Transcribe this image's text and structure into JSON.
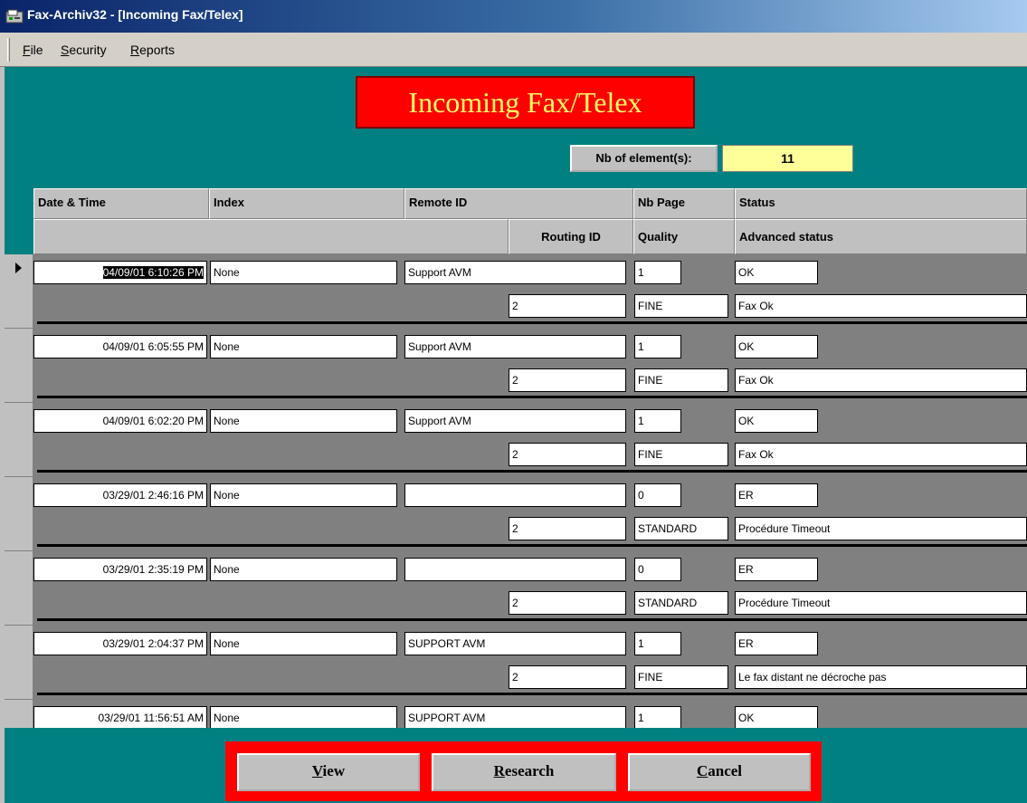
{
  "window": {
    "title": "Fax-Archiv32 - [Incoming Fax/Telex]"
  },
  "menu": [
    {
      "pre": "",
      "key": "F",
      "post": "ile"
    },
    {
      "pre": "",
      "key": "S",
      "post": "ecurity"
    },
    {
      "pre": "",
      "key": "R",
      "post": "eports"
    }
  ],
  "banner": "Incoming Fax/Telex",
  "count": {
    "label": "Nb of element(s):",
    "value": "11"
  },
  "headers": {
    "date_time": "Date & Time",
    "index": "Index",
    "remote_id": "Remote ID",
    "nb_page": "Nb Page",
    "status": "Status",
    "routing_id": "Routing ID",
    "quality": "Quality",
    "advanced_status": "Advanced status"
  },
  "records": [
    {
      "datetime": "04/09/01 6:10:26 PM",
      "index": "None",
      "remote_id": "Support AVM",
      "nb_page": "1",
      "status": "OK",
      "routing_id": "2",
      "quality": "FINE",
      "advanced_status": "Fax Ok",
      "current": true
    },
    {
      "datetime": "04/09/01 6:05:55 PM",
      "index": "None",
      "remote_id": "Support AVM",
      "nb_page": "1",
      "status": "OK",
      "routing_id": "2",
      "quality": "FINE",
      "advanced_status": "Fax Ok"
    },
    {
      "datetime": "04/09/01 6:02:20 PM",
      "index": "None",
      "remote_id": "Support AVM",
      "nb_page": "1",
      "status": "OK",
      "routing_id": "2",
      "quality": "FINE",
      "advanced_status": "Fax Ok"
    },
    {
      "datetime": "03/29/01 2:46:16 PM",
      "index": "None",
      "remote_id": "",
      "nb_page": "0",
      "status": "ER",
      "routing_id": "2",
      "quality": "STANDARD",
      "advanced_status": "Procédure Timeout"
    },
    {
      "datetime": "03/29/01 2:35:19 PM",
      "index": "None",
      "remote_id": "",
      "nb_page": "0",
      "status": "ER",
      "routing_id": "2",
      "quality": "STANDARD",
      "advanced_status": "Procédure Timeout"
    },
    {
      "datetime": "03/29/01 2:04:37 PM",
      "index": "None",
      "remote_id": "SUPPORT AVM",
      "nb_page": "1",
      "status": "ER",
      "routing_id": "2",
      "quality": "FINE",
      "advanced_status": "Le fax distant ne décroche pas"
    },
    {
      "datetime": "03/29/01 11:56:51 AM",
      "index": "None",
      "remote_id": "SUPPORT AVM",
      "nb_page": "1",
      "status": "OK",
      "routing_id": "",
      "quality": "",
      "advanced_status": ""
    }
  ],
  "buttons": {
    "view": {
      "key": "V",
      "rest": "iew"
    },
    "research": {
      "key": "R",
      "rest": "esearch"
    },
    "cancel": {
      "key": "C",
      "rest": "ancel"
    }
  },
  "icons": {
    "app": "fax-app-icon",
    "record_pointer": "current-record-arrow-icon"
  },
  "colors": {
    "background": "#008080",
    "banner_bg": "#ff0000",
    "banner_text": "#ffff66",
    "count_bg": "#ffff99",
    "button_bar": "#ff0000"
  }
}
